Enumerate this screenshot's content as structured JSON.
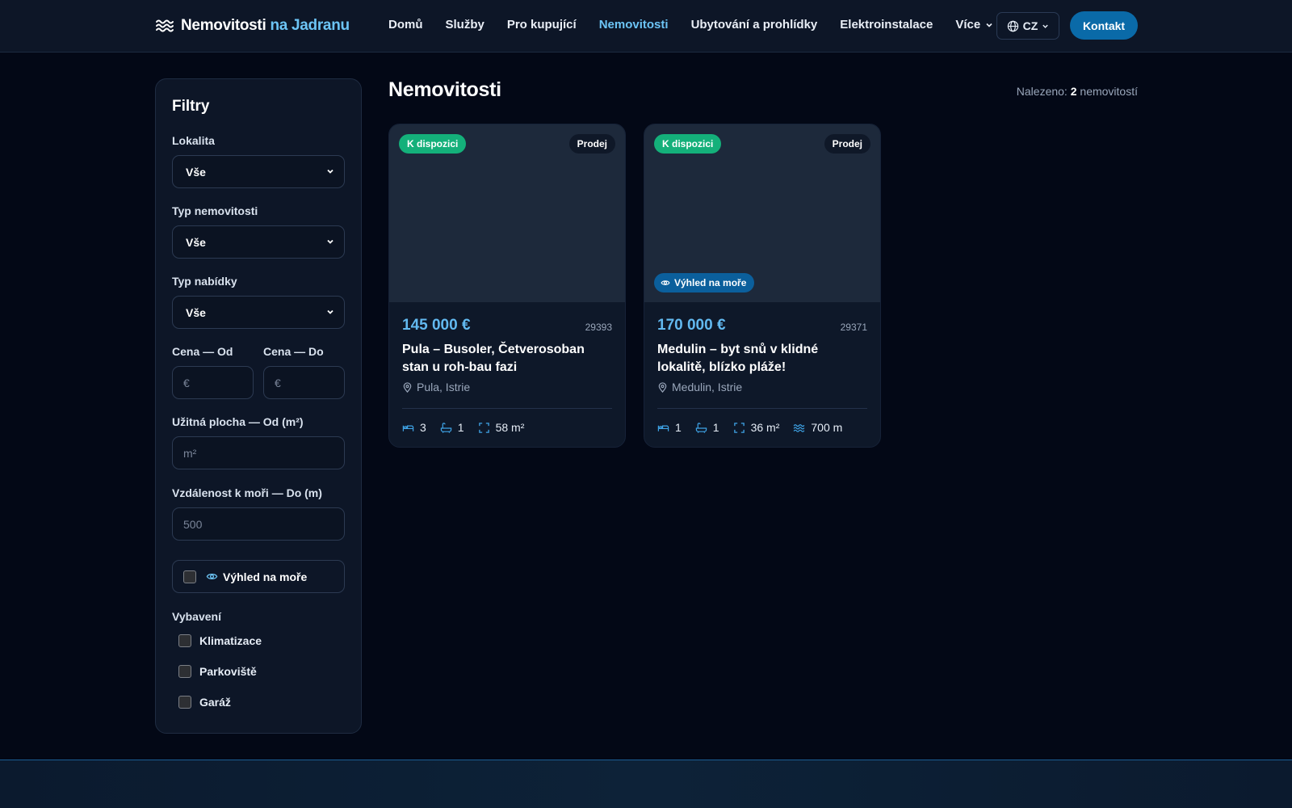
{
  "brand": {
    "name_part1": "Nemovitosti",
    "name_part2": "na Jadranu",
    "icon": "waves-icon"
  },
  "nav": {
    "items": [
      {
        "label": "Domů",
        "active": false
      },
      {
        "label": "Služby",
        "active": false
      },
      {
        "label": "Pro kupující",
        "active": false
      },
      {
        "label": "Nemovitosti",
        "active": true
      },
      {
        "label": "Ubytování a prohlídky",
        "active": false
      },
      {
        "label": "Elektroinstalace",
        "active": false
      },
      {
        "label": "Více",
        "active": false,
        "icon": "chevron-down-icon"
      }
    ],
    "language": "CZ",
    "contact_label": "Kontakt"
  },
  "colors": {
    "accent": "#6cc4f5",
    "primary_button": "#0a6aa8",
    "available_badge": "#14b07a",
    "background": "#030816",
    "panel": "#0d1627"
  },
  "filters": {
    "title": "Filtry",
    "location": {
      "label": "Lokalita",
      "value": "Vše"
    },
    "property_type": {
      "label": "Typ nemovitosti",
      "value": "Vše"
    },
    "offer_type": {
      "label": "Typ nabídky",
      "value": "Vše"
    },
    "price_from": {
      "label": "Cena — Od",
      "placeholder": "€"
    },
    "price_to": {
      "label": "Cena — Do",
      "placeholder": "€"
    },
    "area_from": {
      "label": "Užitná plocha — Od (m²)",
      "placeholder": "m²"
    },
    "sea_distance": {
      "label": "Vzdálenost k moři — Do (m)",
      "placeholder": "500"
    },
    "sea_view": {
      "label": "Výhled na moře",
      "checked": false
    },
    "amenities": {
      "label": "Vybavení",
      "items": [
        {
          "label": "Klimatizace",
          "checked": false
        },
        {
          "label": "Parkoviště",
          "checked": false
        },
        {
          "label": "Garáž",
          "checked": false
        }
      ]
    }
  },
  "main": {
    "title": "Nemovitosti",
    "found_prefix": "Nalezeno:",
    "found_count": "2",
    "found_suffix": "nemovitostí"
  },
  "listings": [
    {
      "status": "K dispozici",
      "type": "Prodej",
      "sea_view_badge": null,
      "price": "145 000 €",
      "ref": "29393",
      "title": "Pula – Busoler, Četverosoban stan u roh-bau fazi",
      "location": "Pula, Istrie",
      "bedrooms": "3",
      "bathrooms": "1",
      "area": "58 m²",
      "sea_distance": null
    },
    {
      "status": "K dispozici",
      "type": "Prodej",
      "sea_view_badge": "Výhled na moře",
      "price": "170 000 €",
      "ref": "29371",
      "title": "Medulin – byt snů v klidné lokalitě, blízko pláže!",
      "location": "Medulin, Istrie",
      "bedrooms": "1",
      "bathrooms": "1",
      "area": "36 m²",
      "sea_distance": "700 m"
    }
  ]
}
